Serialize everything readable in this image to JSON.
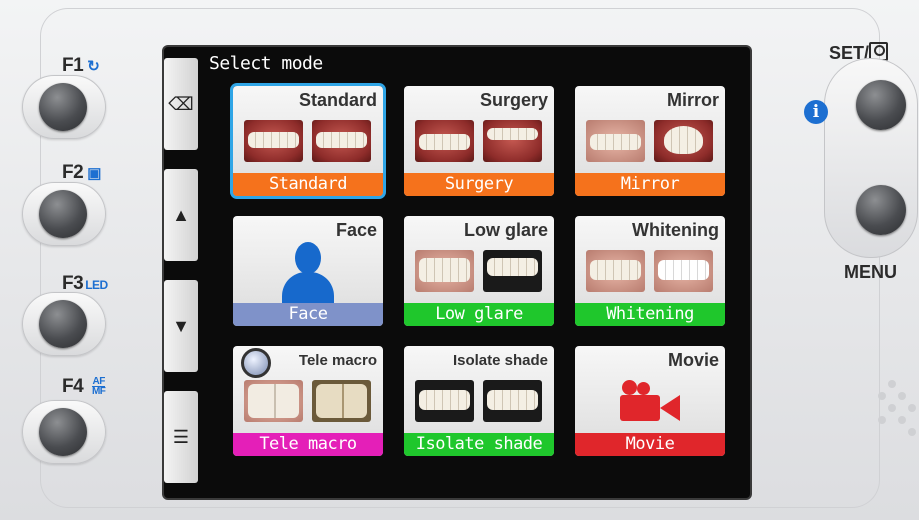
{
  "left_keys": [
    {
      "label": "F1",
      "icon": "flash-icon",
      "glyph": "↻"
    },
    {
      "label": "F2",
      "icon": "exposure-icon",
      "glyph": "▣"
    },
    {
      "label": "F3",
      "icon": "led-icon",
      "glyph": "LED"
    },
    {
      "label": "F4",
      "icon": "af-mf-icon",
      "glyph_top": "AF",
      "glyph_bottom": "MF"
    }
  ],
  "right_keys": {
    "set_label": "SET/",
    "set_icon": "magnify-icon",
    "menu_label": "MENU",
    "info_glyph": "i"
  },
  "screen": {
    "title": "Select mode",
    "side_buttons": [
      {
        "name": "back-button",
        "glyph": "⌫"
      },
      {
        "name": "scroll-up-button",
        "glyph": "▲"
      },
      {
        "name": "scroll-down-button",
        "glyph": "▼"
      },
      {
        "name": "list-view-button",
        "glyph": "☰"
      }
    ],
    "modes": [
      {
        "name": "Standard",
        "label": "Standard",
        "bar_color": "#f5721c",
        "selected": true
      },
      {
        "name": "Surgery",
        "label": "Surgery",
        "bar_color": "#f5721c",
        "selected": false
      },
      {
        "name": "Mirror",
        "label": "Mirror",
        "bar_color": "#f5721c",
        "selected": false
      },
      {
        "name": "Face",
        "label": "Face",
        "bar_color": "#7f92c9",
        "selected": false
      },
      {
        "name": "Low glare",
        "label": "Low glare",
        "bar_color": "#1fc72c",
        "selected": false
      },
      {
        "name": "Whitening",
        "label": "Whitening",
        "bar_color": "#1fc72c",
        "selected": false
      },
      {
        "name": "Tele macro",
        "label": "Tele macro",
        "bar_color": "#e41fb8",
        "selected": false
      },
      {
        "name": "Isolate shade",
        "label": "Isolate shade",
        "bar_color": "#1fc72c",
        "selected": false
      },
      {
        "name": "Movie",
        "label": "Movie",
        "bar_color": "#e0262b",
        "selected": false
      }
    ]
  },
  "colors": {
    "selection": "#2fa5e6",
    "accent_blue": "#1d6fd1"
  }
}
